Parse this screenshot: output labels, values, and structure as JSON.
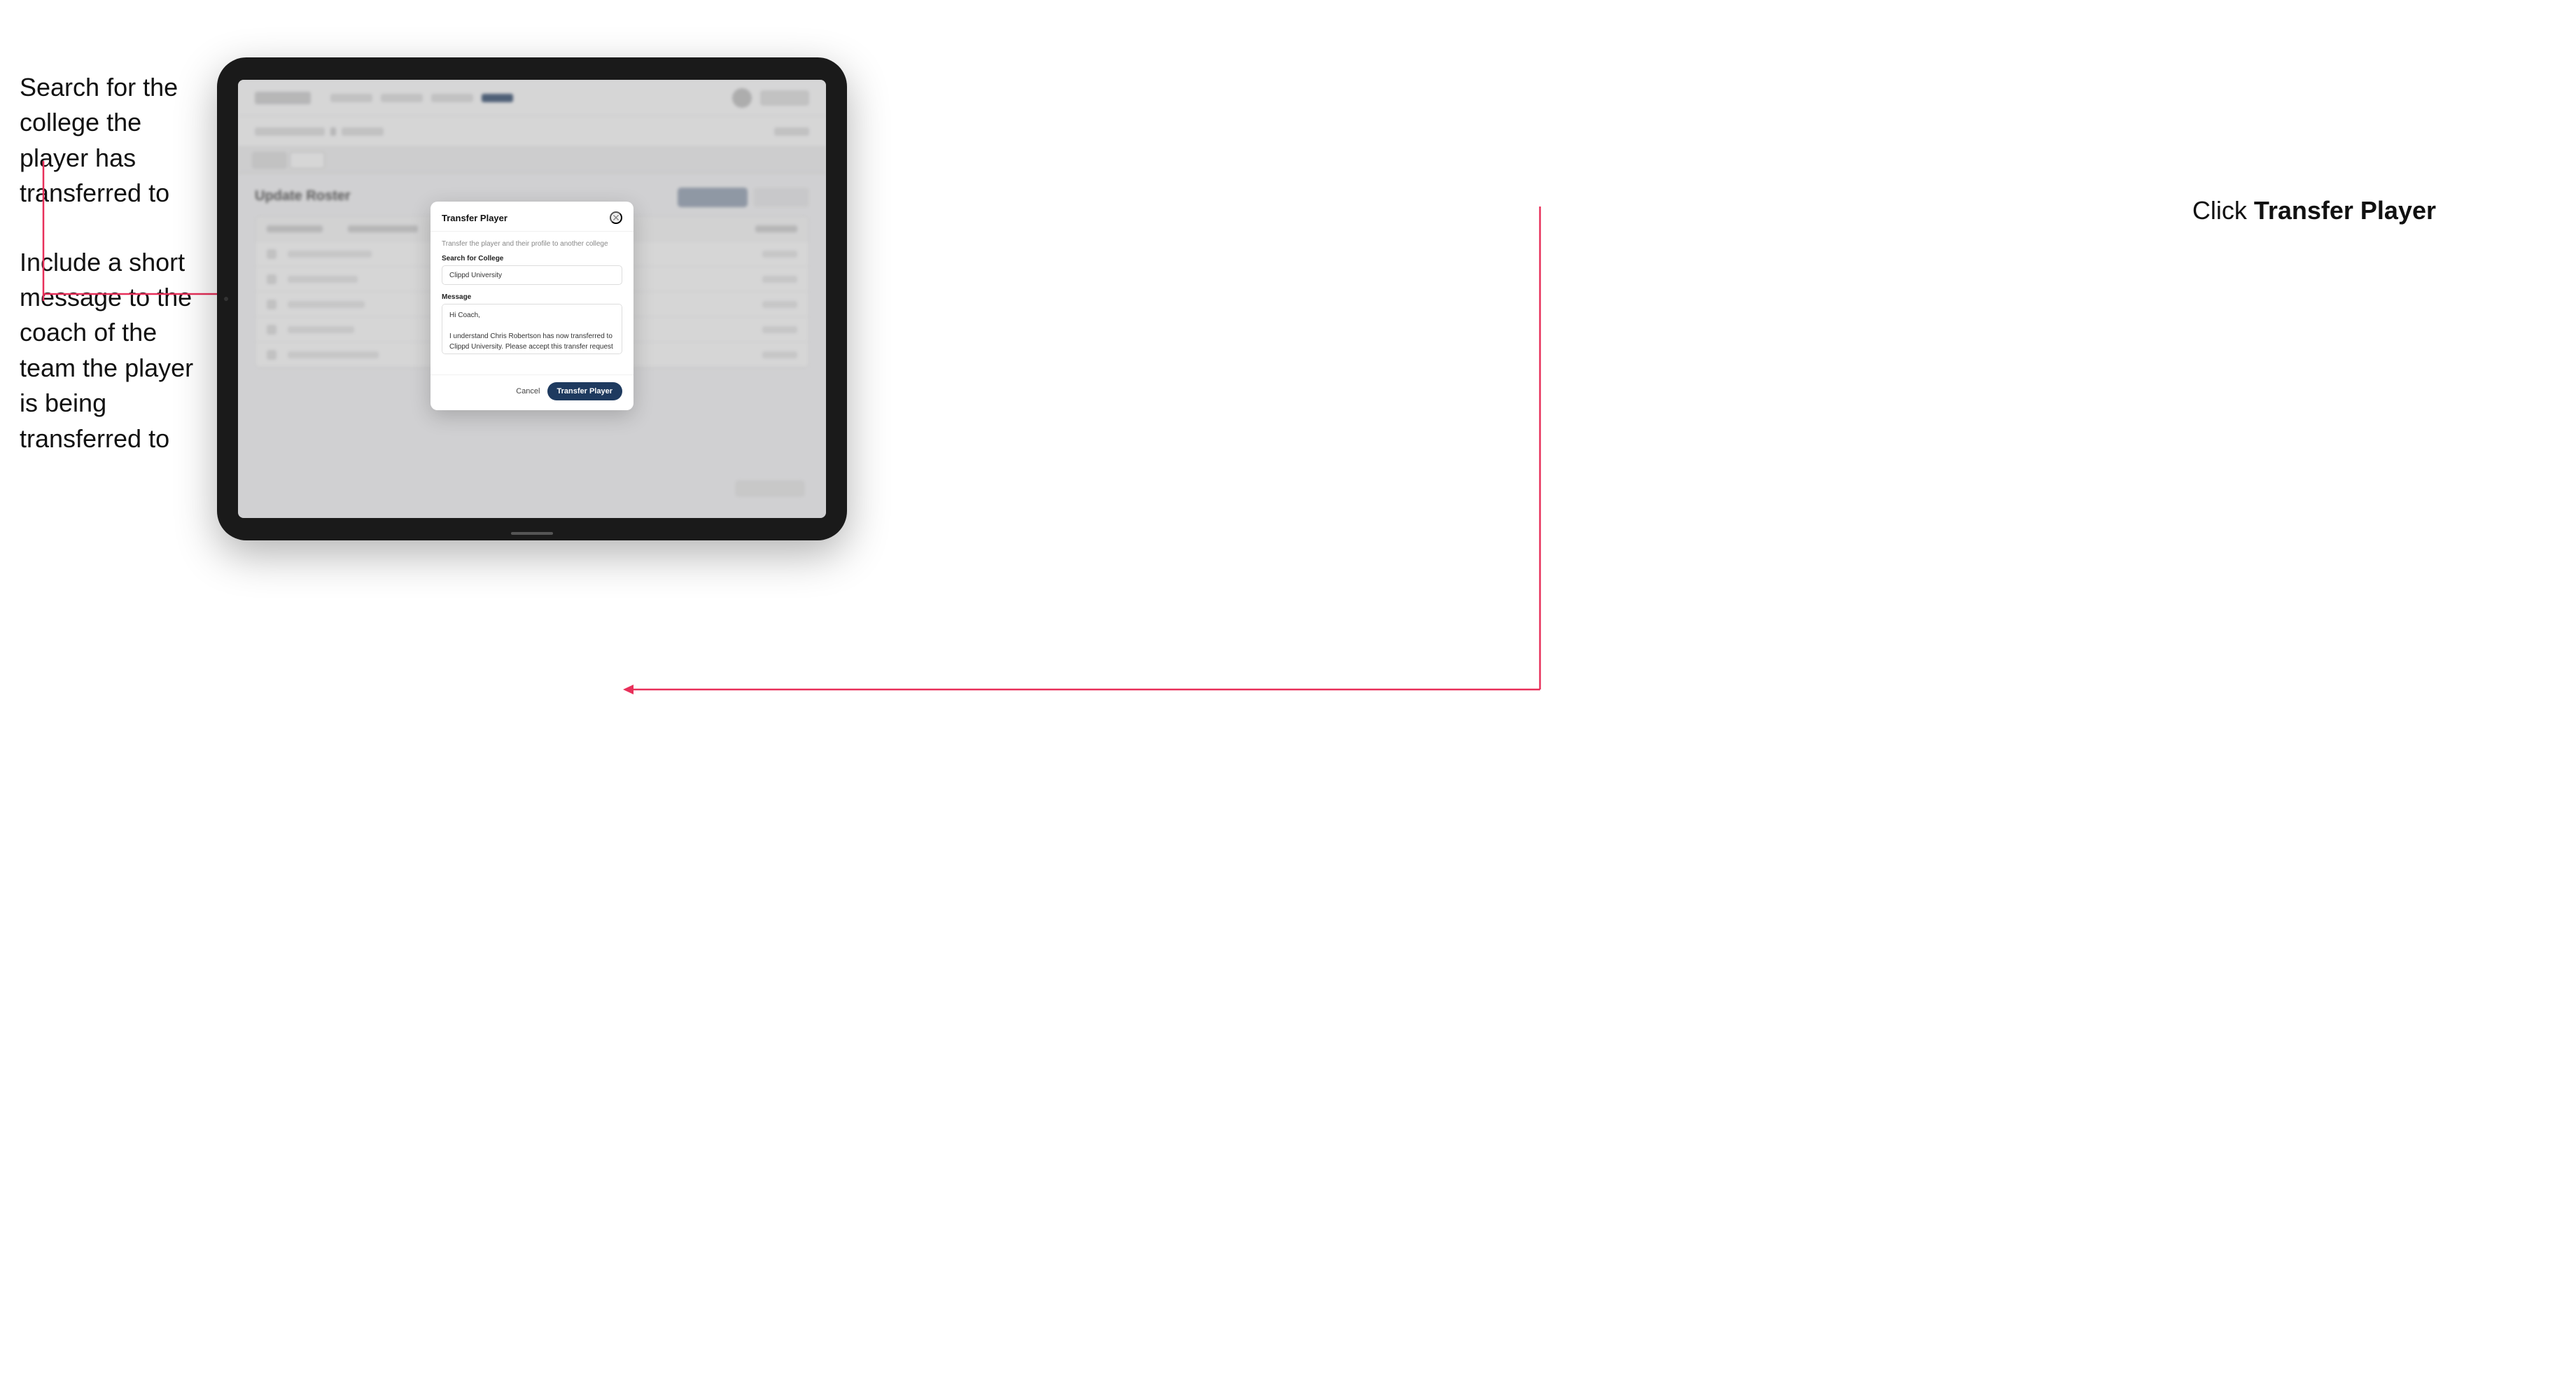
{
  "annotations": {
    "left_top": "Search for the college the player has transferred to",
    "left_bottom": "Include a short message to the coach of the team the player is being transferred to",
    "right_prefix": "Click ",
    "right_action": "Transfer Player"
  },
  "modal": {
    "title": "Transfer Player",
    "description": "Transfer the player and their profile to another college",
    "search_label": "Search for College",
    "search_value": "Clippd University",
    "message_label": "Message",
    "message_value": "Hi Coach,\n\nI understand Chris Robertson has now transferred to Clippd University. Please accept this transfer request when you can.",
    "cancel_label": "Cancel",
    "submit_label": "Transfer Player"
  },
  "background": {
    "page_title": "Update Roster"
  }
}
